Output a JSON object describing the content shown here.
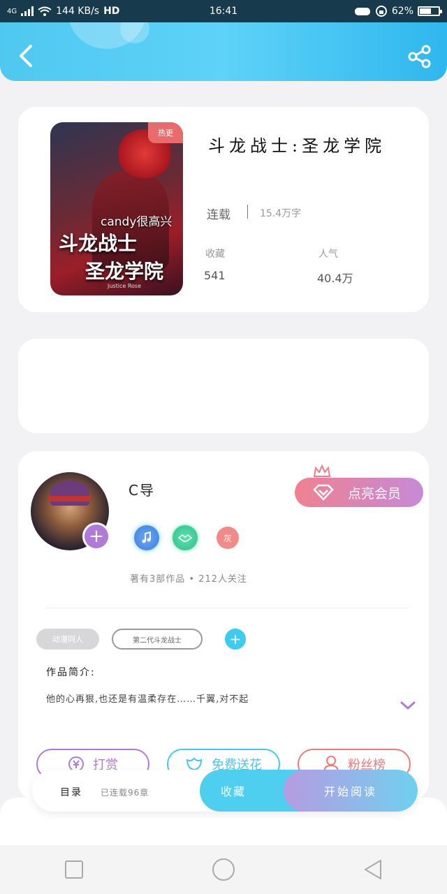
{
  "status_bar": {
    "signal": "4G",
    "speed": "144 KB/s",
    "hd": "HD",
    "time": "16:41",
    "battery": "62%",
    "battery_level": 0.62
  },
  "book": {
    "tag": "热更",
    "cover_author": "candy很高兴",
    "cover_title_1": "斗龙战士",
    "cover_title_2": "圣龙学院",
    "cover_small": "Justice Rose",
    "title": "斗龙战士:圣龙学院",
    "status": "连载",
    "words": "15.4万字",
    "favorites_label": "收藏",
    "favorites_value": "541",
    "popularity_label": "人气",
    "popularity_value": "40.4万"
  },
  "author": {
    "name": "C导",
    "vip_label": "点亮会员",
    "badge_3": "灰",
    "meta": "著有3部作品 • 212人关注",
    "tags": [
      "动漫同人",
      "第二代斗龙战士"
    ],
    "intro_label": "作品简介:",
    "intro_text": "他的心再狠,也还是有温柔存在……千翼,对不起"
  },
  "actions": {
    "reward": "打赏",
    "flowers": "免费送花",
    "fans": "粉丝榜"
  },
  "bottom_bar": {
    "toc": "目录",
    "serial": "已连载96章",
    "collect": "收藏",
    "read": "开始阅读"
  },
  "colors": {
    "header": "#4fc8f0",
    "vip_gradient_start": "#f08090",
    "vip_gradient_end": "#c68ad8",
    "reward": "#b07ad8",
    "flowers": "#3fcaf0",
    "fans": "#f07a7a"
  }
}
